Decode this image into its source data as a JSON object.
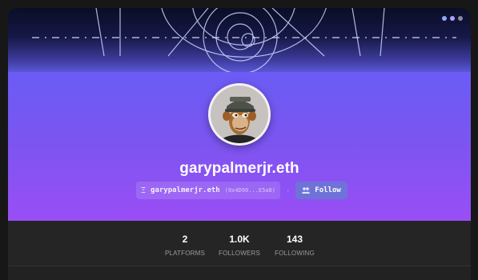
{
  "banner": {
    "dot_colors": [
      "#8ea8ff",
      "#b39dff",
      "#8a8aa8"
    ]
  },
  "profile": {
    "username": "garypalmerjr.eth",
    "address_prefix": "Ξ",
    "address_name": "garypalmerjr.eth",
    "address_short": "(0x4D90...E5a8)",
    "separator": "·",
    "follow_label": "Follow"
  },
  "stats": [
    {
      "value": "2",
      "label": "PLATFORMS"
    },
    {
      "value": "1.0K",
      "label": "FOLLOWERS"
    },
    {
      "value": "143",
      "label": "FOLLOWING"
    }
  ]
}
